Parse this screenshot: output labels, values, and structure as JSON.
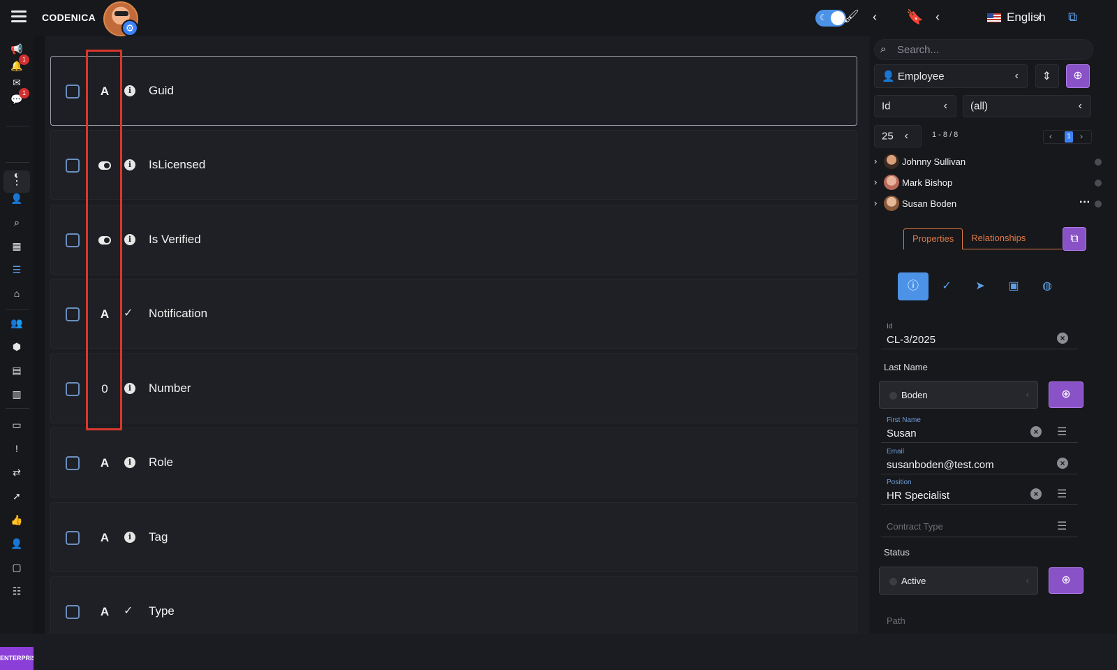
{
  "app": {
    "brand": "CODENICA"
  },
  "header": {
    "language": "English",
    "icons": [
      "menu-icon",
      "theme-toggle",
      "paintbrush-icon",
      "bookmark-icon",
      "sitemap-icon"
    ]
  },
  "nav": {
    "badges": {
      "notifications": "1",
      "chat": "1"
    },
    "enterprise_label": "ENTERPRISE"
  },
  "fields": [
    {
      "type": "A",
      "type_kind": "text",
      "meta": "info",
      "label": "Guid"
    },
    {
      "type": "",
      "type_kind": "boolean",
      "meta": "info",
      "label": "IsLicensed"
    },
    {
      "type": "",
      "type_kind": "boolean",
      "meta": "info",
      "label": "Is Verified"
    },
    {
      "type": "A",
      "type_kind": "text",
      "meta": "validated",
      "label": "Notification"
    },
    {
      "type": "0",
      "type_kind": "number",
      "meta": "info",
      "label": "Number"
    },
    {
      "type": "A",
      "type_kind": "text",
      "meta": "info",
      "label": "Role"
    },
    {
      "type": "A",
      "type_kind": "text",
      "meta": "info",
      "label": "Tag"
    },
    {
      "type": "A",
      "type_kind": "text",
      "meta": "validated",
      "label": "Type"
    }
  ],
  "panel": {
    "search_placeholder": "Search...",
    "entity": "Employee",
    "sort_field": "Id",
    "filter": "(all)",
    "page_size": "25",
    "range": "1 - 8 / 8",
    "page": "1",
    "records": [
      {
        "name": "Johnny Sullivan"
      },
      {
        "name": "Mark Bishop"
      },
      {
        "name": "Susan Boden"
      }
    ],
    "tabs": {
      "properties": "Properties",
      "relationships": "Relationships"
    },
    "form": {
      "id_label": "Id",
      "id_value": "CL-3/2025",
      "last_name_label": "Last Name",
      "last_name_value": "Boden",
      "first_name_label": "First Name",
      "first_name_value": "Susan",
      "email_label": "Email",
      "email_value": "susanboden@test.com",
      "position_label": "Position",
      "position_value": "HR Specialist",
      "contract_type_placeholder": "Contract Type",
      "status_label": "Status",
      "status_value": "Active",
      "path_placeholder": "Path"
    }
  },
  "colors": {
    "accent": "#4c93e8",
    "purple": "#8a52c7",
    "highlight": "#d9372a",
    "tab": "#e07a44"
  }
}
